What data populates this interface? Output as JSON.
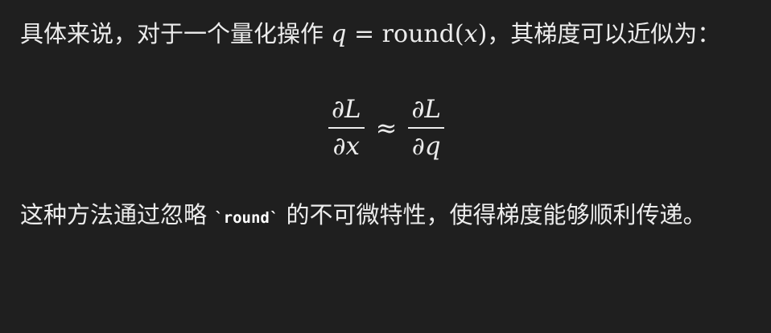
{
  "paragraph1": {
    "text_before": "具体来说，对于一个量化操作 ",
    "math_q": "q",
    "math_eq": " = ",
    "math_round": "round",
    "math_paren_open": "(",
    "math_x": "x",
    "math_paren_close": ")",
    "text_after": "，其梯度可以近似为："
  },
  "equation": {
    "lhs_numerator": "∂L",
    "lhs_denominator": "∂x",
    "relation": "≈",
    "rhs_numerator": "∂L",
    "rhs_denominator": "∂q"
  },
  "paragraph2": {
    "text_before": "这种方法通过忽略 ",
    "code": "`round`",
    "text_after": " 的不可微特性，使得梯度能够顺利传递。"
  }
}
